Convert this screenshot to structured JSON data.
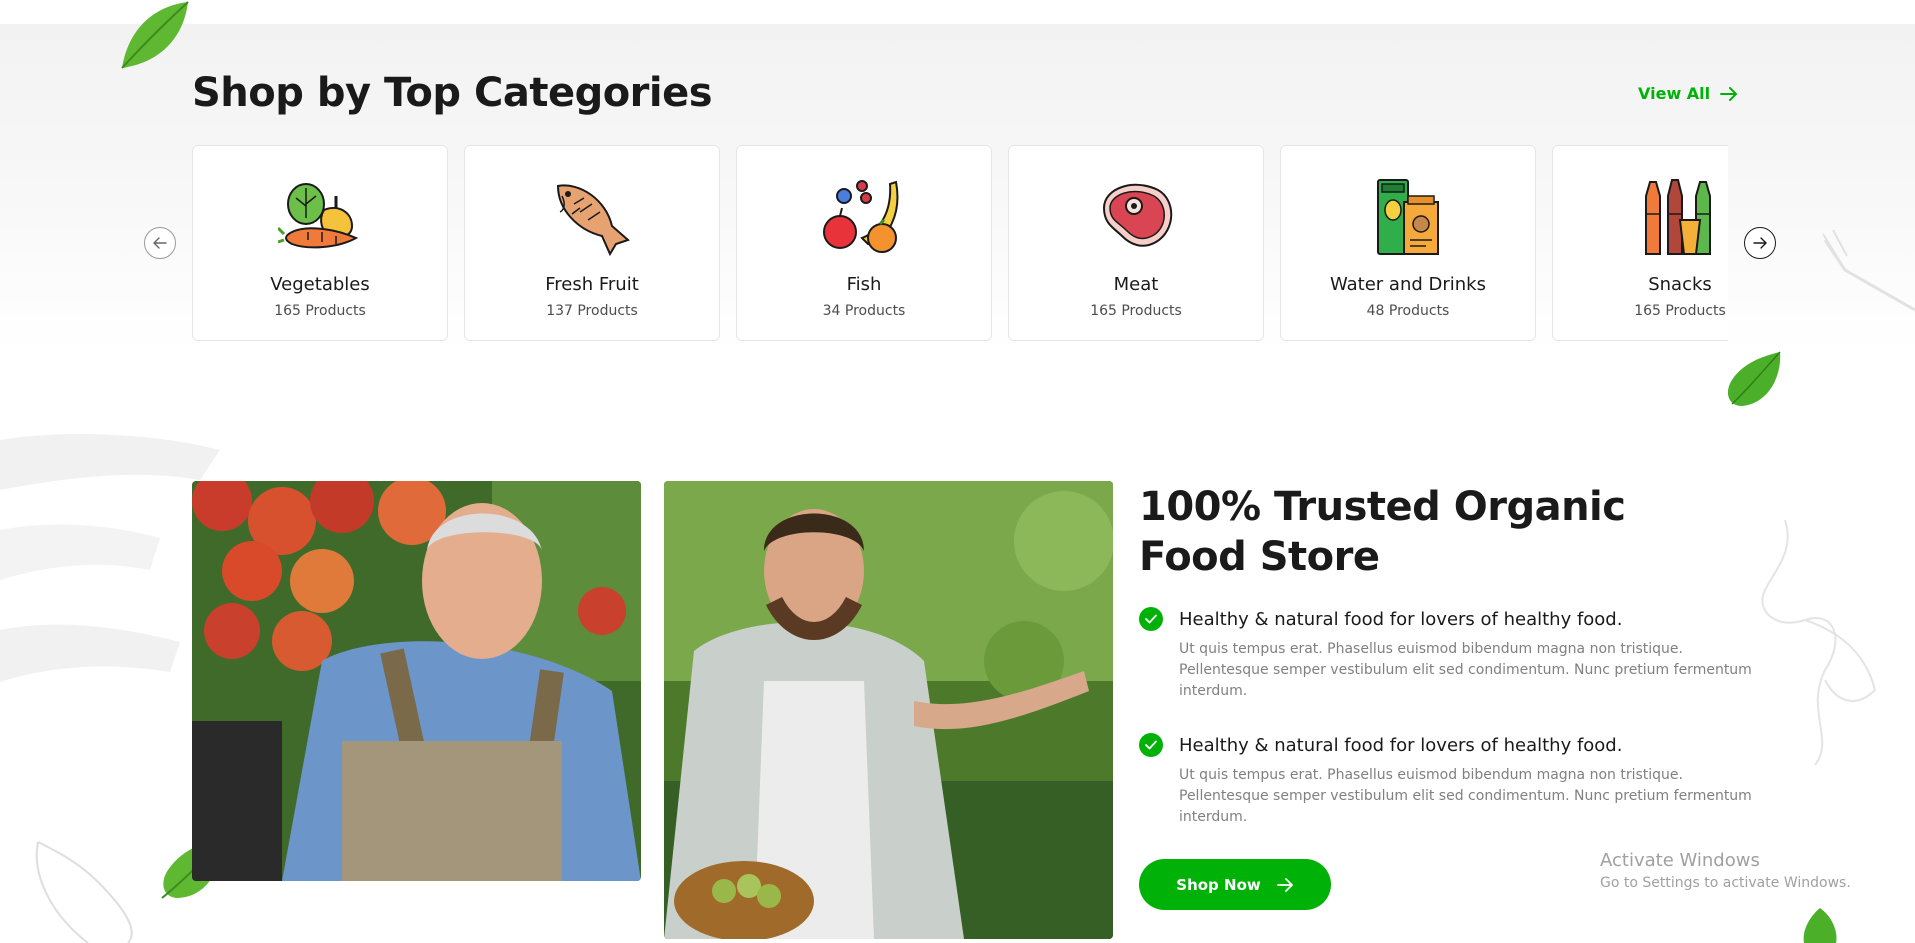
{
  "categories_section": {
    "title": "Shop by Top Categories",
    "view_all_label": "View All",
    "items": [
      {
        "name": "Vegetables",
        "count": "165 Products",
        "icon": "vegetables-icon"
      },
      {
        "name": "Fresh Fruit",
        "count": "137 Products",
        "icon": "fish-icon"
      },
      {
        "name": "Fish",
        "count": "34 Products",
        "icon": "fruits-icon"
      },
      {
        "name": "Meat",
        "count": "165 Products",
        "icon": "meat-icon"
      },
      {
        "name": "Water and Drinks",
        "count": "48 Products",
        "icon": "drinks-icon"
      },
      {
        "name": "Snacks",
        "count": "165 Products",
        "icon": "bottles-icon"
      }
    ]
  },
  "about_section": {
    "title": "100% Trusted Organic Food Store",
    "features": [
      {
        "title": "Healthy & natural food for lovers of healthy food.",
        "description": "Ut quis tempus erat. Phasellus euismod bibendum magna non tristique. Pellentesque semper vestibulum elit sed condimentum. Nunc pretium fermentum interdum."
      },
      {
        "title": "Healthy & natural food for lovers of healthy food.",
        "description": "Ut quis tempus erat. Phasellus euismod bibendum magna non tristique. Pellentesque semper vestibulum elit sed condimentum. Nunc pretium fermentum interdum."
      }
    ],
    "button_label": "Shop Now"
  },
  "watermark": {
    "title": "Activate Windows",
    "subtitle": "Go to Settings to activate Windows."
  },
  "colors": {
    "brand_green": "#00b207",
    "heading": "#1a1a1a",
    "muted_text": "#808080"
  }
}
